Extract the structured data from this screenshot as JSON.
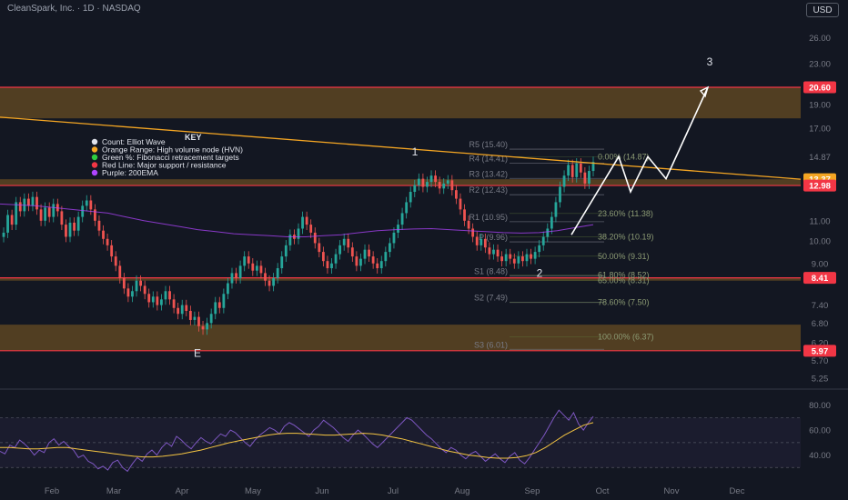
{
  "header": {
    "symbol_line": "CleanSpark, Inc. · 1D · NASDAQ",
    "currency_button": "USD"
  },
  "chart_data": {
    "type": "candlestick",
    "price_axis": {
      "scale": "log",
      "range": [
        5.05,
        28.5
      ],
      "ticks": [
        "26.00",
        "23.00",
        "20.60",
        "19.00",
        "17.00",
        "14.87",
        "13.37",
        "12.98",
        "11.00",
        "10.00",
        "9.00",
        "8.41",
        "7.40",
        "6.80",
        "6.20",
        "5.97",
        "5.70",
        "5.25"
      ]
    },
    "time_axis": {
      "labels": [
        "Feb",
        "Mar",
        "Apr",
        "May",
        "Jun",
        "Jul",
        "Aug",
        "Sep",
        "Oct",
        "Nov",
        "Dec"
      ]
    },
    "price_tags": [
      {
        "value": "20.60",
        "color": "#f23645"
      },
      {
        "value": "13.37",
        "color": "#f5a623"
      },
      {
        "value": "12.98",
        "color": "#f23645"
      },
      {
        "value": "8.41",
        "color": "#f23645"
      },
      {
        "value": "5.97",
        "color": "#f23645"
      }
    ],
    "legend": {
      "title": "KEY",
      "items": [
        {
          "label": "Count: Elliot Wave",
          "color": "#e0e3eb"
        },
        {
          "label": "Orange Range: High volume node (HVN)",
          "color": "#f5a623"
        },
        {
          "label": "Green %: Fibonacci retracement targets",
          "color": "#2ecc40"
        },
        {
          "label": "Red Line: Major support / resistance",
          "color": "#f23645"
        },
        {
          "label": "Purple: 200EMA",
          "color": "#b044ff"
        }
      ]
    },
    "hvn_zones": [
      {
        "from": 17.8,
        "to": 20.6
      },
      {
        "from": 12.98,
        "to": 13.37
      },
      {
        "from": 8.3,
        "to": 8.41
      },
      {
        "from": 5.97,
        "to": 6.75
      }
    ],
    "support_resistance": [
      20.6,
      12.98,
      8.41,
      5.97
    ],
    "trendline": {
      "start": [
        "Jan",
        17.9
      ],
      "end": [
        "Oct",
        13.37
      ]
    },
    "pivot_levels": [
      {
        "label": "R5 (15.40)",
        "value": 15.4
      },
      {
        "label": "R4 (14.41)",
        "value": 14.41
      },
      {
        "label": "R3 (13.42)",
        "value": 13.42
      },
      {
        "label": "R2 (12.43)",
        "value": 12.43
      },
      {
        "label": "R1 (10.95)",
        "value": 10.95
      },
      {
        "label": "P (9.96)",
        "value": 9.96
      },
      {
        "label": "S1 (8.48)",
        "value": 8.48
      },
      {
        "label": "S2 (7.49)",
        "value": 7.49
      },
      {
        "label": "S3 (6.01)",
        "value": 6.01
      }
    ],
    "fib_levels": [
      {
        "label": "0.00% (14.87)",
        "value": 14.87
      },
      {
        "label": "23.60% (11.38)",
        "value": 11.38
      },
      {
        "label": "38.20% (10.19)",
        "value": 10.19
      },
      {
        "label": "50.00% (9.31)",
        "value": 9.31
      },
      {
        "label": "61.80% (8.52)",
        "value": 8.52
      },
      {
        "label": "65.00% (8.31)",
        "value": 8.31
      },
      {
        "label": "78.60% (7.50)",
        "value": 7.5
      },
      {
        "label": "100.00% (6.37)",
        "value": 6.37
      }
    ],
    "wave_labels": [
      {
        "label": "E",
        "date": "Apr",
        "price": 5.9
      },
      {
        "label": "1",
        "date": "Jul",
        "price": 15.2
      },
      {
        "label": "2",
        "date": "Sep",
        "price": 8.6
      },
      {
        "label": "3",
        "date": "Oct",
        "price": 23.2
      }
    ],
    "projection_path": [
      10.3,
      14.87,
      12.6,
      14.87,
      13.4,
      20.6
    ],
    "closes": [
      10.4,
      11.3,
      10.8,
      12.0,
      11.5,
      12.2,
      11.8,
      12.3,
      11.6,
      11.0,
      11.7,
      11.2,
      11.9,
      11.5,
      10.8,
      10.2,
      10.9,
      10.5,
      11.2,
      11.8,
      12.1,
      11.6,
      11.0,
      10.5,
      10.1,
      9.8,
      9.3,
      8.9,
      8.4,
      8.0,
      7.7,
      7.9,
      8.3,
      8.1,
      7.8,
      7.5,
      7.7,
      7.4,
      7.6,
      7.9,
      7.6,
      7.3,
      7.1,
      7.4,
      7.2,
      6.9,
      7.0,
      6.7,
      6.6,
      6.8,
      7.1,
      7.5,
      7.3,
      7.8,
      8.2,
      8.6,
      8.4,
      8.9,
      9.3,
      9.0,
      8.7,
      8.9,
      8.6,
      8.3,
      8.1,
      8.4,
      8.8,
      9.3,
      9.8,
      10.3,
      10.1,
      10.6,
      11.2,
      10.8,
      10.4,
      9.9,
      9.5,
      9.1,
      8.8,
      9.0,
      9.4,
      9.8,
      10.1,
      9.7,
      9.3,
      8.9,
      9.2,
      9.6,
      9.3,
      9.0,
      8.8,
      9.1,
      9.5,
      9.9,
      10.4,
      10.8,
      11.4,
      12.0,
      12.6,
      13.0,
      13.4,
      12.9,
      13.2,
      13.6,
      13.2,
      12.8,
      13.1,
      13.3,
      12.7,
      12.2,
      11.6,
      11.0,
      10.6,
      10.2,
      9.8,
      10.1,
      9.7,
      9.4,
      9.6,
      9.3,
      9.1,
      9.4,
      9.2,
      9.0,
      9.3,
      9.1,
      9.4,
      9.2,
      9.5,
      9.8,
      10.2,
      10.6,
      11.2,
      12.0,
      12.9,
      13.6,
      14.3,
      13.5,
      14.4,
      13.8,
      13.1,
      13.9,
      14.5
    ],
    "ema200": [
      11.9,
      11.85,
      11.8,
      11.7,
      11.6,
      11.5,
      11.4,
      11.2,
      11.0,
      10.85,
      10.7,
      10.55,
      10.45,
      10.35,
      10.3,
      10.25,
      10.2,
      10.2,
      10.25,
      10.3,
      10.4,
      10.5,
      10.55,
      10.58,
      10.6,
      10.55,
      10.5,
      10.45,
      10.4,
      10.38,
      10.4,
      10.5,
      10.65,
      10.8
    ],
    "rsi": {
      "range": [
        20,
        90
      ],
      "ticks": [
        "80.00",
        "60.00",
        "40.00"
      ],
      "upper_band": 70,
      "lower_band": 30,
      "values": [
        43,
        41,
        48,
        46,
        52,
        49,
        45,
        40,
        44,
        42,
        50,
        53,
        48,
        51,
        47,
        44,
        38,
        40,
        35,
        33,
        29,
        31,
        28,
        34,
        36,
        30,
        27,
        33,
        38,
        35,
        41,
        44,
        40,
        46,
        50,
        47,
        55,
        52,
        48,
        45,
        50,
        54,
        51,
        49,
        53,
        57,
        55,
        60,
        58,
        54,
        50,
        47,
        52,
        56,
        59,
        62,
        60,
        57,
        63,
        66,
        64,
        61,
        58,
        55,
        60,
        63,
        68,
        65,
        62,
        58,
        54,
        51,
        56,
        60,
        57,
        53,
        49,
        46,
        50,
        54,
        58,
        62,
        66,
        70,
        68,
        64,
        60,
        56,
        53,
        49,
        45,
        42,
        46,
        44,
        40,
        37,
        41,
        43,
        39,
        35,
        38,
        41,
        37,
        34,
        39,
        42,
        36,
        33,
        38,
        44,
        50,
        56,
        63,
        70,
        76,
        72,
        68,
        74,
        65,
        60,
        66,
        71
      ],
      "ma": [
        46,
        46,
        45.5,
        45,
        45,
        45.5,
        46,
        46,
        45,
        44,
        43,
        42,
        41,
        40,
        39,
        38.5,
        38.5,
        39,
        40,
        41,
        42.5,
        44,
        46,
        48,
        50,
        51.5,
        53,
        54.5,
        56,
        57,
        57.5,
        57.5,
        57,
        56.5,
        56,
        56,
        56.5,
        57,
        57.5,
        57,
        56,
        54.5,
        53,
        51,
        49,
        47,
        45,
        43,
        41.5,
        40,
        39,
        38,
        37.5,
        37.5,
        38,
        39.5,
        42,
        46,
        51,
        56,
        60,
        64,
        66
      ]
    }
  }
}
